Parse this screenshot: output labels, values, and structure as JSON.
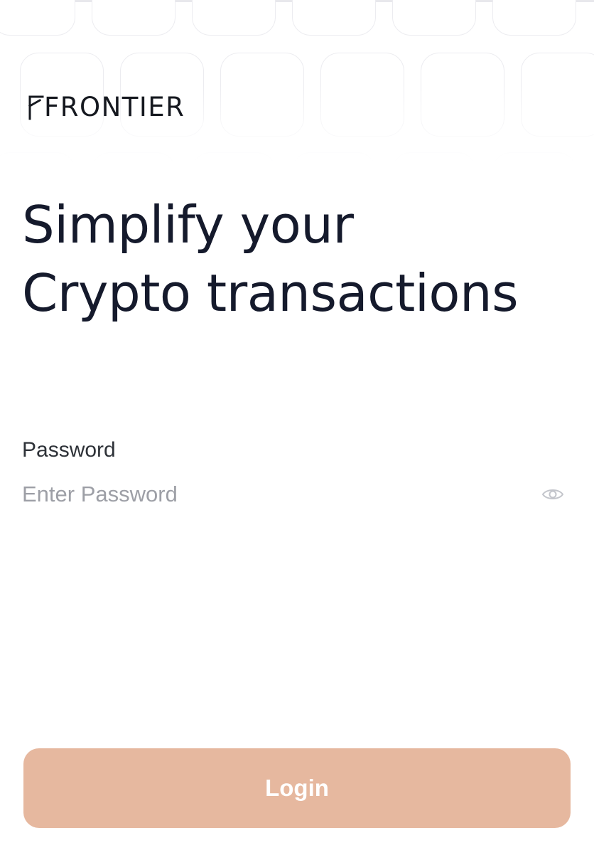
{
  "brand": {
    "logo_text": "FRONTIER"
  },
  "hero": {
    "line1": "Simplify your",
    "line2": "Crypto transactions"
  },
  "password": {
    "label": "Password",
    "placeholder": "Enter Password",
    "value": ""
  },
  "icons": {
    "visibility_toggle": "eye-icon"
  },
  "actions": {
    "login_label": "Login"
  },
  "colors": {
    "login_button": "#e6b89f",
    "heading_text": "#151a2c",
    "placeholder_text": "#9d9fa6"
  }
}
